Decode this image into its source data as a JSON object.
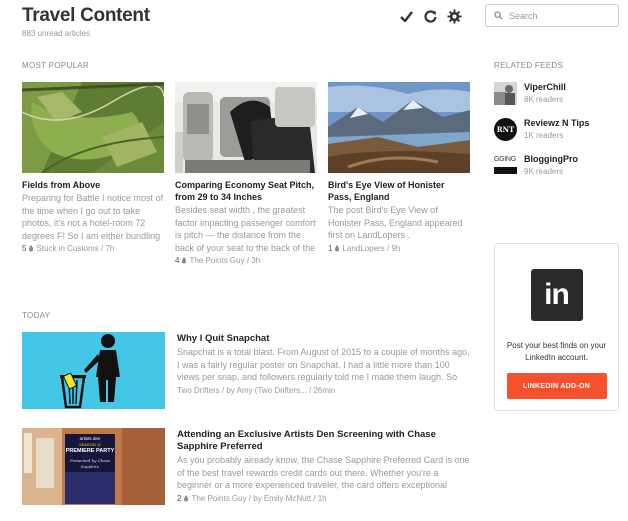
{
  "header": {
    "title": "Travel Content",
    "subtitle": "883 unread articles"
  },
  "toolbar": {
    "icons": [
      "check-icon",
      "refresh-icon",
      "gear-icon"
    ]
  },
  "search": {
    "placeholder": "Search"
  },
  "sections": {
    "most_popular": "MOST POPULAR",
    "related_feeds": "RELATED FEEDS",
    "today": "TODAY"
  },
  "popular": [
    {
      "title": "Fields from Above",
      "snippet": "Preparing for Battle I notice most of the time when I go out to take photos, it's not a hotel-room 72 degrees F! So I am either bundling",
      "count": "5",
      "source": "Stuck in Customs / 7h"
    },
    {
      "title": "Comparing Economy Seat Pitch, from 29 to 34 Inches",
      "snippet": "Besides seat width , the greatest factor impacting passenger comfort is pitch — the distance from the back of your seat to the back of the",
      "count": "4",
      "source": "The Points Guy / 3h"
    },
    {
      "title": "Bird's Eye View of Honister Pass, England",
      "snippet": "The post Bird's Eye View of Honister Pass, England appeared first on LandLopers .",
      "count": "1",
      "source": "LandLopers / 9h"
    }
  ],
  "feeds": [
    {
      "name": "ViperChill",
      "readers": "8K readers",
      "icon": "viperchill-avatar"
    },
    {
      "name": "Reviewz N Tips",
      "readers": "1K readers",
      "icon": "rnt-logo",
      "logo_text": "RNT"
    },
    {
      "name": "BloggingPro",
      "readers": "9K readers",
      "icon": "bloggingpro-logo",
      "logo_text": "GGING"
    }
  ],
  "today": [
    {
      "title": "Why I Quit Snapchat",
      "snippet": "Snapchat is a total blast. From August of 2015 to a couple of months ago, I was a fairly regular poster on Snapchat. I had a little more than 100 views per snap, and followers regularly told me I made them laugh. So",
      "source": "Two Drifters / by Amy (Two Drifters... / 26min"
    },
    {
      "title": "Attending an Exclusive Artists Den Screening with Chase Sapphire Preferred",
      "snippet": "As you probably already know, the Chase Sapphire Preferred Card is one of the best travel rewards credit cards out there. Whether you're a beginner or a more experienced traveler, the card offers exceptional",
      "count": "2",
      "source": "The Points Guy / by Emily McNutt / 1h",
      "poster": {
        "brand": "artists den",
        "season": "SEASON 11",
        "headline": "PREMIERE PARTY",
        "script": "Presented by Chase Sapphire"
      }
    }
  ],
  "ad": {
    "logo_text": "in",
    "text": "Post your best finds on your LinkedIn account.",
    "button": "LINKEDIN ADD-ON"
  },
  "colors": {
    "accent": "#f4512c",
    "snapchat_bg": "#44c7e6",
    "linkedin_bg": "#2b2b2b"
  }
}
